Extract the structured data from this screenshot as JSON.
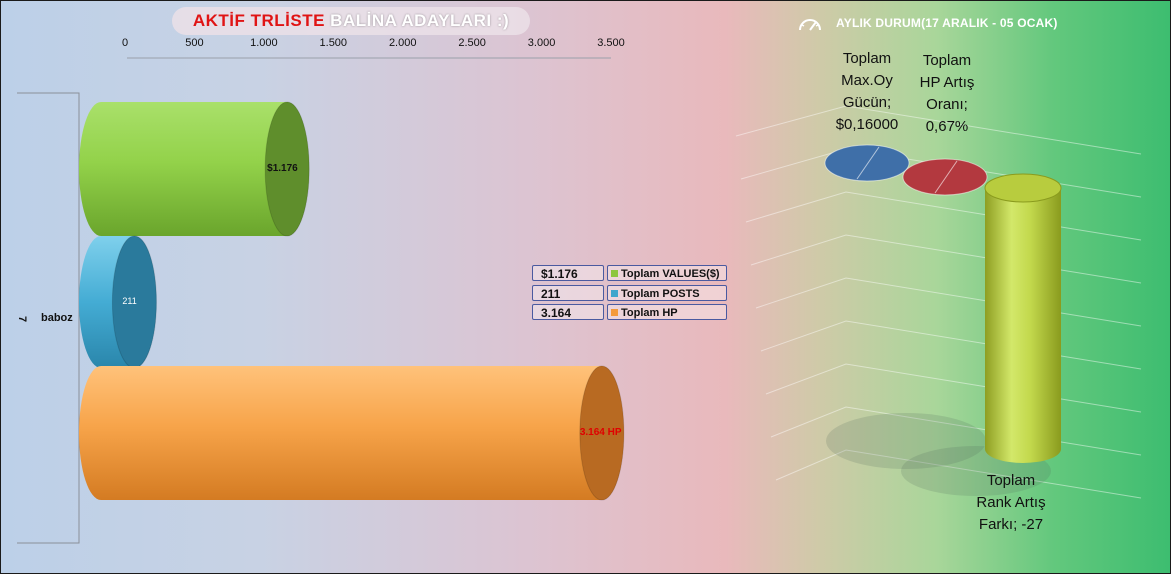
{
  "title": {
    "part1": "AKTİF TRLİSTE",
    "part2": "BALİNA ADAYLARI :)"
  },
  "chart_data": [
    {
      "type": "bar",
      "orientation": "horizontal",
      "x_ticks": [
        "0",
        "500",
        "1.000",
        "1.500",
        "2.000",
        "2.500",
        "3.000",
        "3.500"
      ],
      "xlim": [
        0,
        3500
      ],
      "category": {
        "rank": "7",
        "name": "baboz"
      },
      "series": [
        {
          "name": "Toplam VALUES($)",
          "value": 1176,
          "label": "$1.176",
          "color": "#8dc63f"
        },
        {
          "name": "Toplam POSTS",
          "value": 211,
          "label": "211",
          "color": "#3fa6cc"
        },
        {
          "name": "Toplam HP",
          "value": 3164,
          "label": "3.164 HP",
          "color": "#f39a3c"
        }
      ],
      "legend": [
        {
          "value": "$1.176",
          "name": "Toplam VALUES($)",
          "color": "#8dc63f"
        },
        {
          "value": "211",
          "name": "Toplam POSTS",
          "color": "#3fa6cc"
        },
        {
          "value": "3.164",
          "name": "Toplam HP",
          "color": "#f39a3c"
        }
      ]
    },
    {
      "type": "bar",
      "title": "AYLIK DURUM(17 ARALIK - 05 OCAK)",
      "series": [
        {
          "name": "Toplam Max.Oy Gücün",
          "value": 0.16,
          "label_lines": [
            "Toplam",
            "Max.Oy",
            "Gücün;",
            "$0,16000"
          ],
          "color": "#3a6ea8"
        },
        {
          "name": "Toplam HP Artış Oranı",
          "value": 0.67,
          "label_lines": [
            "Toplam",
            "HP Artış",
            "Oranı;",
            "0,67%"
          ],
          "color": "#b03a3a"
        },
        {
          "name": "Toplam Rank Artış Farkı",
          "value": -27,
          "label_lines": [
            "Toplam",
            "Rank Artış",
            "Farkı; -27"
          ],
          "color": "#b8cc3c"
        }
      ]
    }
  ]
}
